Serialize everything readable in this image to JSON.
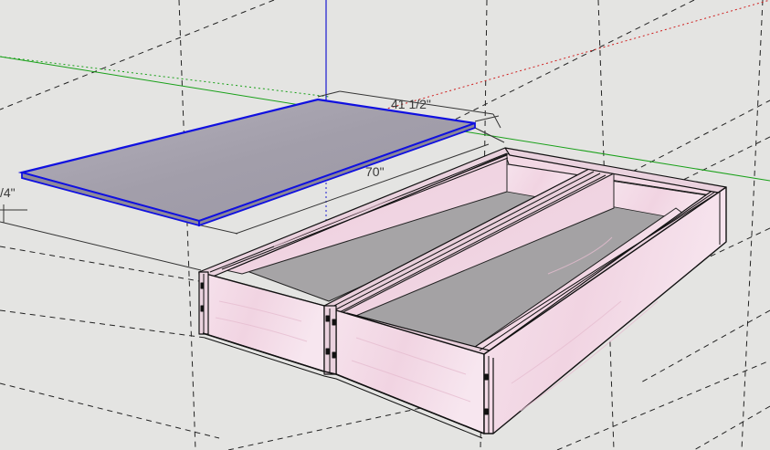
{
  "viewport": {
    "background": "#e4e4e2"
  },
  "axes": {
    "red_color": "#d02020",
    "green_color": "#18a018",
    "blue_color": "#1a1ad0"
  },
  "dimensions": {
    "width_label": "41 1/2\"",
    "length_label": "70\"",
    "left_partial_label": "/4\""
  },
  "panel": {
    "fill": "#a8a4b0",
    "edge_color": "#1010e0"
  },
  "box": {
    "wood_color": "#f4dce8",
    "edge_color": "#111111"
  }
}
